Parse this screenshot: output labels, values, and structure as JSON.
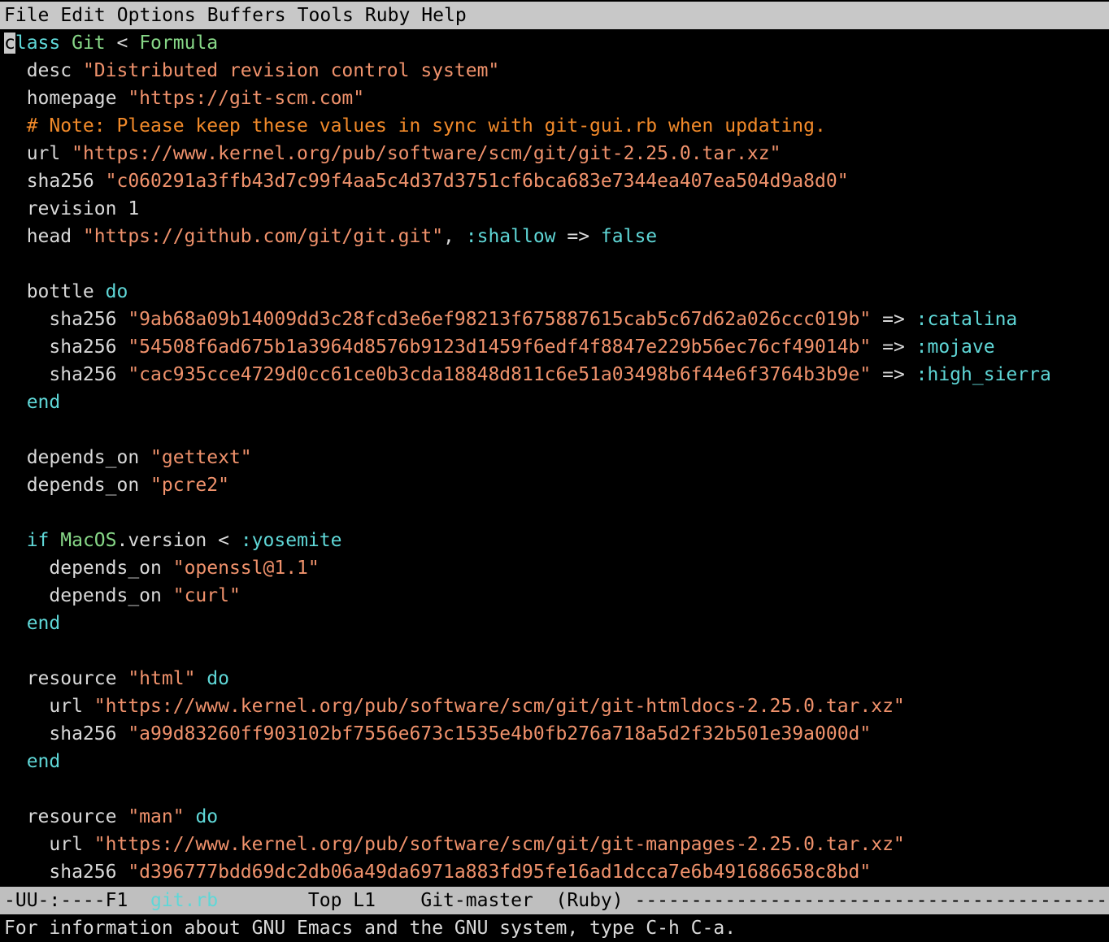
{
  "menu": [
    "File",
    "Edit",
    "Options",
    "Buffers",
    "Tools",
    "Ruby",
    "Help"
  ],
  "colors": {
    "keyword": "#5fd7d7",
    "type": "#87d787",
    "string": "#f0926c",
    "comment": "#f28a2a",
    "plain": "#d9d9d9",
    "menubar_bg": "#c8c8c8",
    "modeline_bg": "#bfbfbf"
  },
  "buffer": {
    "cursor_char": "c",
    "lines": [
      [
        [
          "k",
          "lass "
        ],
        [
          "t",
          "Git"
        ],
        [
          "p",
          " < "
        ],
        [
          "t",
          "Formula"
        ]
      ],
      [
        [
          "p",
          "  desc "
        ],
        [
          "s",
          "\"Distributed revision control system\""
        ]
      ],
      [
        [
          "p",
          "  homepage "
        ],
        [
          "s",
          "\"https://git-scm.com\""
        ]
      ],
      [
        [
          "c",
          "  # Note: Please keep these values in sync with git-gui.rb when updating."
        ]
      ],
      [
        [
          "p",
          "  url "
        ],
        [
          "s",
          "\"https://www.kernel.org/pub/software/scm/git/git-2.25.0.tar.xz\""
        ]
      ],
      [
        [
          "p",
          "  sha256 "
        ],
        [
          "s",
          "\"c060291a3ffb43d7c99f4aa5c4d37d3751cf6bca683e7344ea407ea504d9a8d0\""
        ]
      ],
      [
        [
          "p",
          "  revision 1"
        ]
      ],
      [
        [
          "p",
          "  head "
        ],
        [
          "s",
          "\"https://github.com/git/git.git\""
        ],
        [
          "p",
          ", "
        ],
        [
          "k",
          ":shallow"
        ],
        [
          "p",
          " => "
        ],
        [
          "k",
          "false"
        ]
      ],
      [
        [
          "p",
          ""
        ]
      ],
      [
        [
          "p",
          "  bottle "
        ],
        [
          "k",
          "do"
        ]
      ],
      [
        [
          "p",
          "    sha256 "
        ],
        [
          "s",
          "\"9ab68a09b14009dd3c28fcd3e6ef98213f675887615cab5c67d62a026ccc019b\""
        ],
        [
          "p",
          " => "
        ],
        [
          "k",
          ":catalina"
        ]
      ],
      [
        [
          "p",
          "    sha256 "
        ],
        [
          "s",
          "\"54508f6ad675b1a3964d8576b9123d1459f6edf4f8847e229b56ec76cf49014b\""
        ],
        [
          "p",
          " => "
        ],
        [
          "k",
          ":mojave"
        ]
      ],
      [
        [
          "p",
          "    sha256 "
        ],
        [
          "s",
          "\"cac935cce4729d0cc61ce0b3cda18848d811c6e51a03498b6f44e6f3764b3b9e\""
        ],
        [
          "p",
          " => "
        ],
        [
          "k",
          ":high_sierra"
        ]
      ],
      [
        [
          "p",
          "  "
        ],
        [
          "k",
          "end"
        ]
      ],
      [
        [
          "p",
          ""
        ]
      ],
      [
        [
          "p",
          "  depends_on "
        ],
        [
          "s",
          "\"gettext\""
        ]
      ],
      [
        [
          "p",
          "  depends_on "
        ],
        [
          "s",
          "\"pcre2\""
        ]
      ],
      [
        [
          "p",
          ""
        ]
      ],
      [
        [
          "p",
          "  "
        ],
        [
          "k",
          "if "
        ],
        [
          "t",
          "MacOS"
        ],
        [
          "p",
          ".version < "
        ],
        [
          "k",
          ":yosemite"
        ]
      ],
      [
        [
          "p",
          "    depends_on "
        ],
        [
          "s",
          "\"openssl@1.1\""
        ]
      ],
      [
        [
          "p",
          "    depends_on "
        ],
        [
          "s",
          "\"curl\""
        ]
      ],
      [
        [
          "p",
          "  "
        ],
        [
          "k",
          "end"
        ]
      ],
      [
        [
          "p",
          ""
        ]
      ],
      [
        [
          "p",
          "  resource "
        ],
        [
          "s",
          "\"html\""
        ],
        [
          "p",
          " "
        ],
        [
          "k",
          "do"
        ]
      ],
      [
        [
          "p",
          "    url "
        ],
        [
          "s",
          "\"https://www.kernel.org/pub/software/scm/git/git-htmldocs-2.25.0.tar.xz\""
        ]
      ],
      [
        [
          "p",
          "    sha256 "
        ],
        [
          "s",
          "\"a99d83260ff903102bf7556e673c1535e4b0fb276a718a5d2f32b501e39a000d\""
        ]
      ],
      [
        [
          "p",
          "  "
        ],
        [
          "k",
          "end"
        ]
      ],
      [
        [
          "p",
          ""
        ]
      ],
      [
        [
          "p",
          "  resource "
        ],
        [
          "s",
          "\"man\""
        ],
        [
          "p",
          " "
        ],
        [
          "k",
          "do"
        ]
      ],
      [
        [
          "p",
          "    url "
        ],
        [
          "s",
          "\"https://www.kernel.org/pub/software/scm/git/git-manpages-2.25.0.tar.xz\""
        ]
      ],
      [
        [
          "p",
          "    sha256 "
        ],
        [
          "s",
          "\"d396777bdd69dc2db06a49da6971a883fd95fe16ad1dcca7e6b491686658c8bd\""
        ]
      ]
    ]
  },
  "modeline": {
    "prefix": "-UU-:----F1  ",
    "buffer_name": "git.rb",
    "middle": "        Top L1    Git-master  (Ruby) ",
    "dashes": "--------------------------------------------"
  },
  "echo_area": "For information about GNU Emacs and the GNU system, type C-h C-a."
}
